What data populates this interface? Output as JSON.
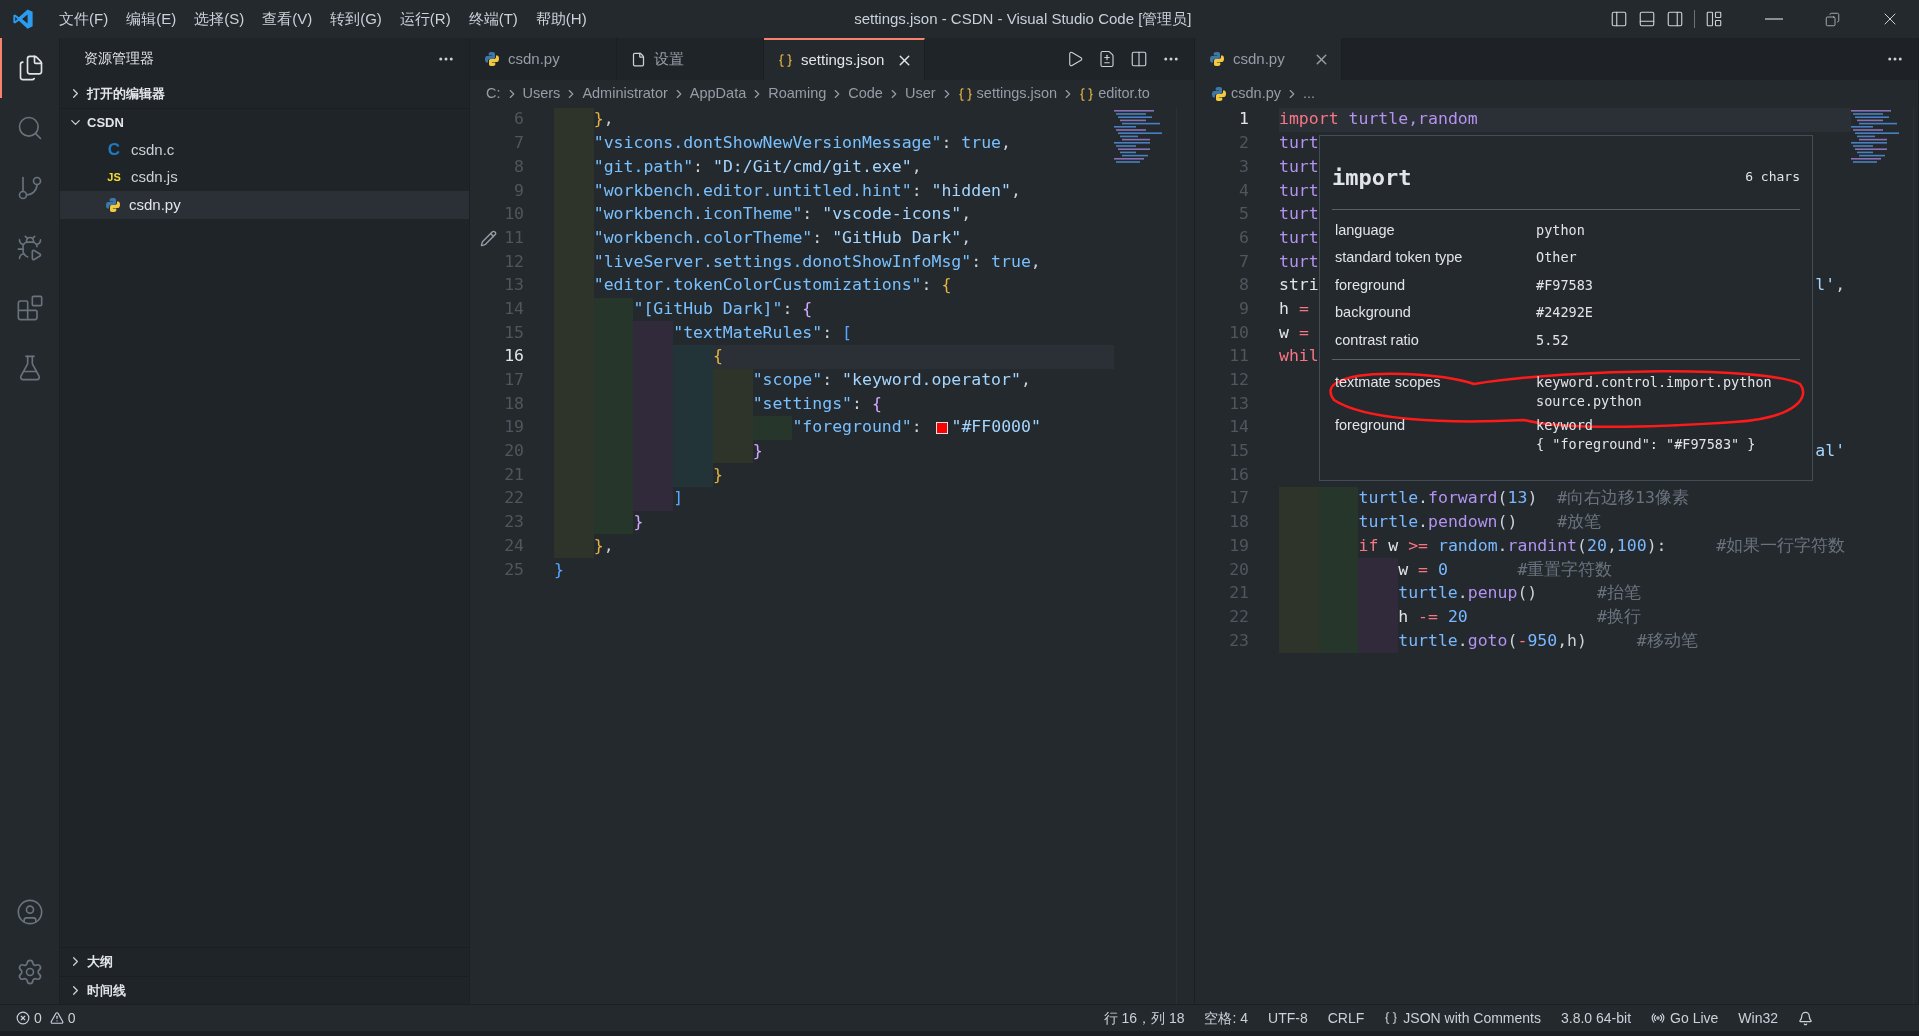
{
  "title_bar": {
    "menu": [
      "文件(F)",
      "编辑(E)",
      "选择(S)",
      "查看(V)",
      "转到(G)",
      "运行(R)",
      "终端(T)",
      "帮助(H)"
    ],
    "title": "settings.json - CSDN - Visual Studio Code [管理员]"
  },
  "activity_bar": {
    "top": [
      {
        "kind": "explorer",
        "selected": true
      },
      {
        "kind": "search",
        "selected": false
      },
      {
        "kind": "scm",
        "selected": false
      },
      {
        "kind": "debug",
        "selected": false
      },
      {
        "kind": "extensions",
        "selected": false
      },
      {
        "kind": "testing",
        "selected": false
      }
    ],
    "bottom": [
      {
        "kind": "account",
        "selected": false
      },
      {
        "kind": "settings",
        "selected": false
      }
    ]
  },
  "sidebar": {
    "title": "资源管理器",
    "sections": [
      {
        "label": "打开的编辑器",
        "expanded": false
      },
      {
        "label": "CSDN",
        "expanded": true,
        "children": [
          {
            "name": "csdn.c",
            "kind": "c",
            "icon_text": "C",
            "selected": false
          },
          {
            "name": "csdn.js",
            "kind": "js",
            "icon_text": "JS",
            "selected": false
          },
          {
            "name": "csdn.py",
            "kind": "py",
            "selected": true
          }
        ]
      }
    ],
    "bottom_sections": [
      {
        "label": "大纲",
        "expanded": false
      },
      {
        "label": "时间线",
        "expanded": false
      }
    ]
  },
  "left_group": {
    "focused": true,
    "tabs": [
      {
        "label": "csdn.py",
        "kind": "py",
        "selected": false
      },
      {
        "label": "设置",
        "kind": "file",
        "selected": false
      },
      {
        "label": "settings.json",
        "kind": "json",
        "selected": true
      }
    ],
    "breadcrumb": [
      {
        "label": "C:"
      },
      {
        "label": "Users"
      },
      {
        "label": "Administrator"
      },
      {
        "label": "AppData"
      },
      {
        "label": "Roaming"
      },
      {
        "label": "Code"
      },
      {
        "label": "User"
      },
      {
        "label": "settings.json",
        "kind": "json"
      },
      {
        "label": "editor.to",
        "kind": "json"
      }
    ],
    "lines": [
      {
        "n": "6",
        "current": false,
        "toks": [
          {
            "kind": "b1",
            "text": "    }"
          },
          {
            "kind": "punc",
            "text": ","
          }
        ]
      },
      {
        "n": "7",
        "current": false,
        "toks": [
          {
            "kind": "key",
            "text": "    \"vsicons.dontShowNewVersionMessage\""
          },
          {
            "kind": "punc",
            "text": ": "
          },
          {
            "kind": "lit",
            "text": "true"
          },
          {
            "kind": "punc",
            "text": ","
          }
        ]
      },
      {
        "n": "8",
        "current": false,
        "toks": [
          {
            "kind": "key",
            "text": "    \"git.path\""
          },
          {
            "kind": "punc",
            "text": ": "
          },
          {
            "kind": "str",
            "text": "\"D:/Git/cmd/git.exe\""
          },
          {
            "kind": "punc",
            "text": ","
          }
        ]
      },
      {
        "n": "9",
        "current": false,
        "toks": [
          {
            "kind": "key",
            "text": "    \"workbench.editor.untitled.hint\""
          },
          {
            "kind": "punc",
            "text": ": "
          },
          {
            "kind": "str",
            "text": "\"hidden\""
          },
          {
            "kind": "punc",
            "text": ","
          }
        ]
      },
      {
        "n": "10",
        "current": false,
        "toks": [
          {
            "kind": "key",
            "text": "    \"workbench.iconTheme\""
          },
          {
            "kind": "punc",
            "text": ": "
          },
          {
            "kind": "str",
            "text": "\"vscode-icons\""
          },
          {
            "kind": "punc",
            "text": ","
          }
        ]
      },
      {
        "n": "11",
        "current": false,
        "pencil": true,
        "toks": [
          {
            "kind": "key",
            "text": "    \"workbench.colorTheme\""
          },
          {
            "kind": "punc",
            "text": ": "
          },
          {
            "kind": "str",
            "text": "\"GitHub Dark\""
          },
          {
            "kind": "punc",
            "text": ","
          }
        ]
      },
      {
        "n": "12",
        "current": false,
        "toks": [
          {
            "kind": "key",
            "text": "    \"liveServer.settings.donotShowInfoMsg\""
          },
          {
            "kind": "punc",
            "text": ": "
          },
          {
            "kind": "lit",
            "text": "true"
          },
          {
            "kind": "punc",
            "text": ","
          }
        ]
      },
      {
        "n": "13",
        "current": false,
        "toks": [
          {
            "kind": "key",
            "text": "    \"editor.tokenColorCustomizations\""
          },
          {
            "kind": "punc",
            "text": ": "
          },
          {
            "kind": "b1",
            "text": "{"
          }
        ]
      },
      {
        "n": "14",
        "current": false,
        "toks": [
          {
            "kind": "key",
            "text": "        \"[GitHub Dark]\""
          },
          {
            "kind": "punc",
            "text": ": "
          },
          {
            "kind": "b2",
            "text": "{"
          }
        ]
      },
      {
        "n": "15",
        "current": false,
        "toks": [
          {
            "kind": "key",
            "text": "            \"textMateRules\""
          },
          {
            "kind": "punc",
            "text": ": "
          },
          {
            "kind": "b3",
            "text": "["
          }
        ]
      },
      {
        "n": "16",
        "current": true,
        "toks": [
          {
            "kind": "b1",
            "text": "                {"
          }
        ]
      },
      {
        "n": "17",
        "current": false,
        "toks": [
          {
            "kind": "key",
            "text": "                    \"scope\""
          },
          {
            "kind": "punc",
            "text": ": "
          },
          {
            "kind": "str",
            "text": "\"keyword.operator\""
          },
          {
            "kind": "punc",
            "text": ","
          }
        ]
      },
      {
        "n": "18",
        "current": false,
        "toks": [
          {
            "kind": "key",
            "text": "                    \"settings\""
          },
          {
            "kind": "punc",
            "text": ": "
          },
          {
            "kind": "b2",
            "text": "{"
          }
        ]
      },
      {
        "n": "19",
        "current": false,
        "toks": [
          {
            "kind": "key",
            "text": "                        \"foreground\""
          },
          {
            "kind": "punc",
            "text": ": "
          },
          {
            "kind": "swatch",
            "color": "#ff0000"
          },
          {
            "kind": "str",
            "text": "\"#FF0000\""
          }
        ]
      },
      {
        "n": "20",
        "current": false,
        "toks": [
          {
            "kind": "b2",
            "text": "                    }"
          }
        ]
      },
      {
        "n": "21",
        "current": false,
        "toks": [
          {
            "kind": "b1",
            "text": "                }"
          }
        ]
      },
      {
        "n": "22",
        "current": false,
        "toks": [
          {
            "kind": "b3",
            "text": "            ]"
          }
        ]
      },
      {
        "n": "23",
        "current": false,
        "toks": [
          {
            "kind": "b2",
            "text": "        }"
          }
        ]
      },
      {
        "n": "24",
        "current": false,
        "toks": [
          {
            "kind": "b1",
            "text": "    }"
          },
          {
            "kind": "punc",
            "text": ","
          }
        ]
      },
      {
        "n": "25",
        "current": false,
        "toks": [
          {
            "kind": "b3",
            "text": "}"
          }
        ]
      }
    ]
  },
  "right_group": {
    "focused": false,
    "tabs": [
      {
        "label": "csdn.py",
        "kind": "py",
        "selected": true
      }
    ],
    "breadcrumb": [
      {
        "label": "csdn.py",
        "kind": "py"
      },
      {
        "label": "..."
      }
    ],
    "lines": [
      {
        "n": "1",
        "current": true,
        "toks": [
          {
            "kind": "kw",
            "text": "import "
          },
          {
            "kind": "mod",
            "text": "turtle,random"
          }
        ]
      },
      {
        "n": "2",
        "current": false,
        "toks": [
          {
            "kind": "mod",
            "text": "turt"
          }
        ]
      },
      {
        "n": "3",
        "current": false,
        "toks": [
          {
            "kind": "mod",
            "text": "turt"
          }
        ]
      },
      {
        "n": "4",
        "current": false,
        "toks": [
          {
            "kind": "mod",
            "text": "turt"
          }
        ]
      },
      {
        "n": "5",
        "current": false,
        "toks": [
          {
            "kind": "mod",
            "text": "turt"
          }
        ]
      },
      {
        "n": "6",
        "current": false,
        "toks": [
          {
            "kind": "mod",
            "text": "turt"
          }
        ]
      },
      {
        "n": "7",
        "current": false,
        "toks": [
          {
            "kind": "mod",
            "text": "turt"
          }
        ]
      },
      {
        "n": "8",
        "current": false,
        "toks": [
          {
            "kind": "id",
            "text": "stri"
          }
        ],
        "tail": [
          {
            "kind": "str",
            "text": "l'"
          },
          {
            "kind": "punc",
            "text": ","
          }
        ]
      },
      {
        "n": "9",
        "current": false,
        "toks": [
          {
            "kind": "id",
            "text": "h "
          },
          {
            "kind": "op",
            "text": "="
          }
        ]
      },
      {
        "n": "10",
        "current": false,
        "toks": [
          {
            "kind": "id",
            "text": "w "
          },
          {
            "kind": "op",
            "text": "="
          }
        ]
      },
      {
        "n": "11",
        "current": false,
        "toks": [
          {
            "kind": "kw",
            "text": "whil"
          }
        ]
      },
      {
        "n": "12",
        "current": false
      },
      {
        "n": "13",
        "current": false
      },
      {
        "n": "14",
        "current": false
      },
      {
        "n": "15",
        "current": false,
        "tail": [
          {
            "kind": "str",
            "text": "al'"
          }
        ]
      },
      {
        "n": "16",
        "current": false
      },
      {
        "n": "17",
        "current": false,
        "toks": [
          {
            "kind": "obj",
            "text": "        turtle"
          },
          {
            "kind": "punc",
            "text": "."
          },
          {
            "kind": "fn",
            "text": "forward"
          },
          {
            "kind": "punc",
            "text": "("
          },
          {
            "kind": "num",
            "text": "13"
          },
          {
            "kind": "punc",
            "text": ")"
          },
          {
            "kind": "cmt",
            "text": "  #向右边移13像素"
          }
        ]
      },
      {
        "n": "18",
        "current": false,
        "toks": [
          {
            "kind": "obj",
            "text": "        turtle"
          },
          {
            "kind": "punc",
            "text": "."
          },
          {
            "kind": "fn",
            "text": "pendown"
          },
          {
            "kind": "punc",
            "text": "()"
          },
          {
            "kind": "cmt",
            "text": "    #放笔"
          }
        ]
      },
      {
        "n": "19",
        "current": false,
        "toks": [
          {
            "kind": "kw",
            "text": "        if"
          },
          {
            "kind": "id",
            "text": " w "
          },
          {
            "kind": "op",
            "text": ">="
          },
          {
            "kind": "obj",
            "text": " random"
          },
          {
            "kind": "punc",
            "text": "."
          },
          {
            "kind": "fn",
            "text": "randint"
          },
          {
            "kind": "punc",
            "text": "("
          },
          {
            "kind": "num",
            "text": "20"
          },
          {
            "kind": "punc",
            "text": ","
          },
          {
            "kind": "num",
            "text": "100"
          },
          {
            "kind": "punc",
            "text": "):"
          },
          {
            "kind": "cmt",
            "text": "     #如果一行字符数"
          }
        ]
      },
      {
        "n": "20",
        "current": false,
        "toks": [
          {
            "kind": "id",
            "text": "            w "
          },
          {
            "kind": "op",
            "text": "="
          },
          {
            "kind": "num",
            "text": " 0"
          },
          {
            "kind": "cmt",
            "text": "       #重置字符数"
          }
        ]
      },
      {
        "n": "21",
        "current": false,
        "toks": [
          {
            "kind": "obj",
            "text": "            turtle"
          },
          {
            "kind": "punc",
            "text": "."
          },
          {
            "kind": "fn",
            "text": "penup"
          },
          {
            "kind": "punc",
            "text": "()"
          },
          {
            "kind": "cmt",
            "text": "      #抬笔"
          }
        ]
      },
      {
        "n": "22",
        "current": false,
        "toks": [
          {
            "kind": "id",
            "text": "            h "
          },
          {
            "kind": "op",
            "text": "-="
          },
          {
            "kind": "num",
            "text": " 20"
          },
          {
            "kind": "cmt",
            "text": "             #换行"
          }
        ]
      },
      {
        "n": "23",
        "current": false,
        "toks": [
          {
            "kind": "obj",
            "text": "            turtle"
          },
          {
            "kind": "punc",
            "text": "."
          },
          {
            "kind": "fn",
            "text": "goto"
          },
          {
            "kind": "punc",
            "text": "("
          },
          {
            "kind": "op",
            "text": "-"
          },
          {
            "kind": "num",
            "text": "950"
          },
          {
            "kind": "punc",
            "text": ",h)"
          },
          {
            "kind": "cmt",
            "text": "     #移动笔"
          }
        ]
      }
    ],
    "hover": {
      "title": "import",
      "length": "6 chars",
      "sections": [
        {
          "rows": [
            {
              "label": "language",
              "values": [
                "python"
              ]
            },
            {
              "label": "standard token type",
              "values": [
                "Other"
              ]
            },
            {
              "label": "foreground",
              "values": [
                "#F97583"
              ]
            },
            {
              "label": "background",
              "values": [
                "#24292E"
              ]
            },
            {
              "label": "contrast ratio",
              "values": [
                "5.52"
              ]
            }
          ]
        },
        {
          "annotated": true,
          "rows": [
            {
              "label": "textmate scopes",
              "values": [
                "keyword.control.import.python",
                "source.python"
              ]
            },
            {
              "label": "foreground",
              "values": [
                "keyword",
                "{ \"foreground\": \"#F97583\" }"
              ]
            }
          ]
        }
      ]
    }
  },
  "status_bar": {
    "errors": "0",
    "warnings": "0",
    "items": [
      {
        "label": "行 16，列 18"
      },
      {
        "label": "空格: 4"
      },
      {
        "label": "UTF-8"
      },
      {
        "label": "CRLF"
      },
      {
        "label": "JSON with Comments",
        "kind": "braces"
      },
      {
        "label": "3.8.0 64-bit"
      },
      {
        "label": "Go Live",
        "kind": "broadcast"
      },
      {
        "label": "Win32"
      }
    ]
  }
}
